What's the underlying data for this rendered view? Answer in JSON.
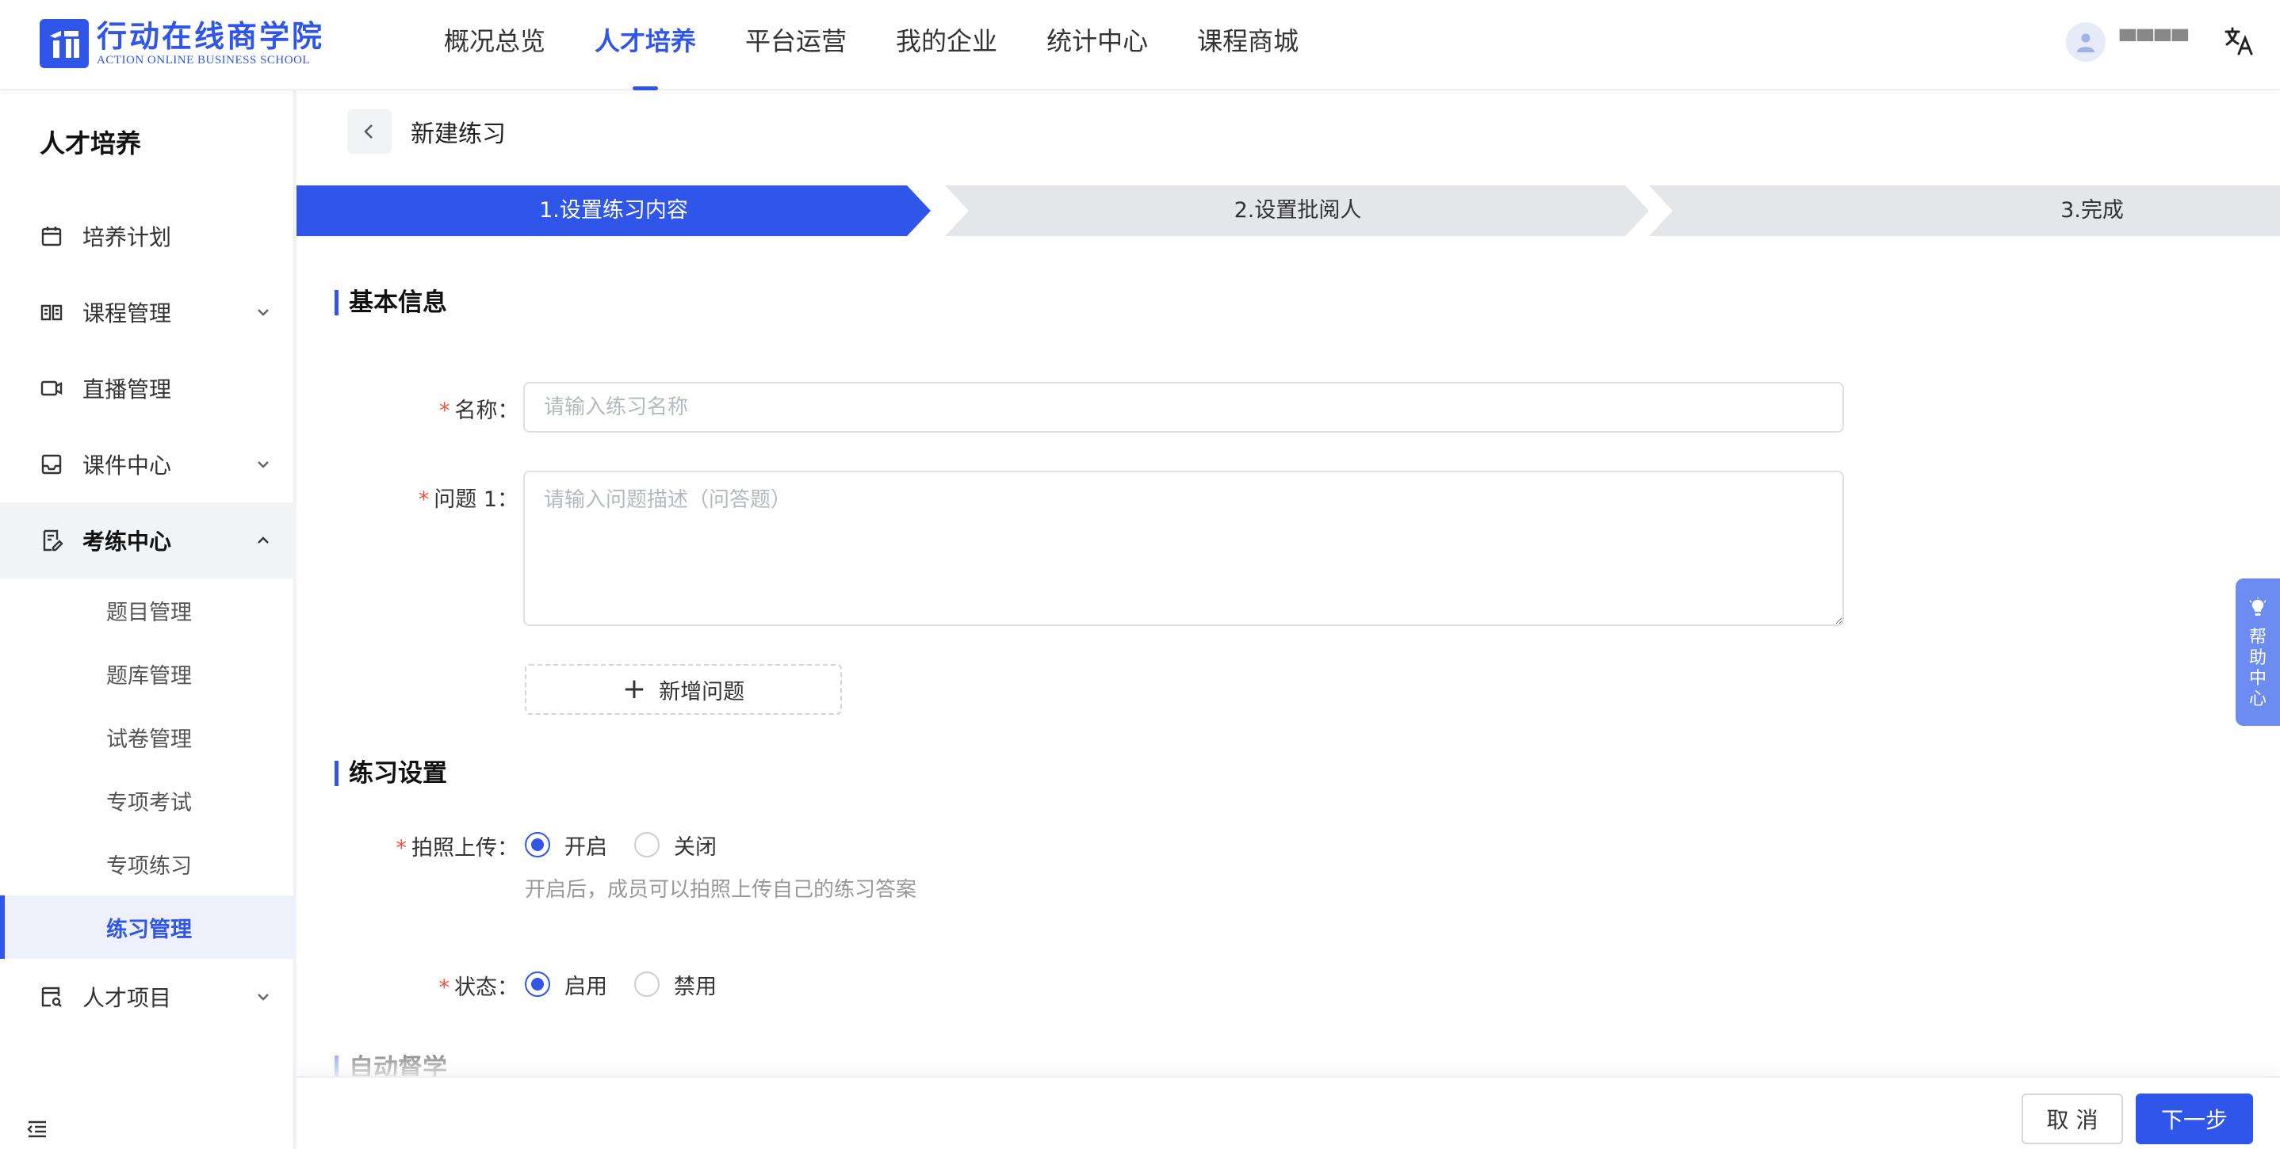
{
  "app": {
    "logo_cn": "行动在线商学院",
    "logo_en": "ACTION ONLINE BUSINESS SCHOOL",
    "brand_color": "#2f56e9"
  },
  "nav": {
    "items": [
      {
        "label": "概况总览",
        "active": false
      },
      {
        "label": "人才培养",
        "active": true
      },
      {
        "label": "平台运营",
        "active": false
      },
      {
        "label": "我的企业",
        "active": false
      },
      {
        "label": "统计中心",
        "active": false
      },
      {
        "label": "课程商城",
        "active": false
      }
    ]
  },
  "user": {
    "name": "▀▀▀▀",
    "avatar_icon": "user-avatar-icon",
    "lang_icon": "translate-icon"
  },
  "sidebar": {
    "title": "人才培养",
    "items": [
      {
        "label": "培养计划",
        "icon": "calendar-icon",
        "has_children": false
      },
      {
        "label": "课程管理",
        "icon": "book-icon",
        "has_children": true
      },
      {
        "label": "直播管理",
        "icon": "video-icon",
        "has_children": false
      },
      {
        "label": "课件中心",
        "icon": "inbox-icon",
        "has_children": true
      },
      {
        "label": "考练中心",
        "icon": "exam-icon",
        "has_children": true,
        "open": true
      },
      {
        "label": "人才项目",
        "icon": "project-icon",
        "has_children": true
      }
    ],
    "exam_children": [
      {
        "label": "题目管理",
        "active": false
      },
      {
        "label": "题库管理",
        "active": false
      },
      {
        "label": "试卷管理",
        "active": false
      },
      {
        "label": "专项考试",
        "active": false
      },
      {
        "label": "专项练习",
        "active": false
      },
      {
        "label": "练习管理",
        "active": true
      }
    ]
  },
  "page": {
    "title": "新建练习",
    "steps": [
      {
        "label": "1.设置练习内容",
        "active": true
      },
      {
        "label": "2.设置批阅人",
        "active": false
      },
      {
        "label": "3.完成",
        "active": false
      }
    ]
  },
  "form": {
    "basic_title": "基本信息",
    "name_label": "名称",
    "name_placeholder": "请输入练习名称",
    "name_value": "",
    "question_label": "问题 1",
    "question_placeholder": "请输入问题描述（问答题）",
    "question_value": "",
    "add_question_label": "新增问题",
    "settings_title": "练习设置",
    "photo_label": "拍照上传",
    "photo_options": [
      {
        "label": "开启",
        "checked": true
      },
      {
        "label": "关闭",
        "checked": false
      }
    ],
    "photo_hint": "开启后，成员可以拍照上传自己的练习答案",
    "status_label": "状态",
    "status_options": [
      {
        "label": "启用",
        "checked": true
      },
      {
        "label": "禁用",
        "checked": false
      }
    ],
    "supervise_title": "自动督学"
  },
  "footer": {
    "cancel_label": "取 消",
    "next_label": "下一步"
  },
  "help": {
    "label": "帮助中心",
    "icon": "lightbulb-icon"
  },
  "colors": {
    "primary": "#2f56e9",
    "step_inactive": "#e4e6ea",
    "required": "#f5513b",
    "help_tab": "#6d8cf2"
  }
}
